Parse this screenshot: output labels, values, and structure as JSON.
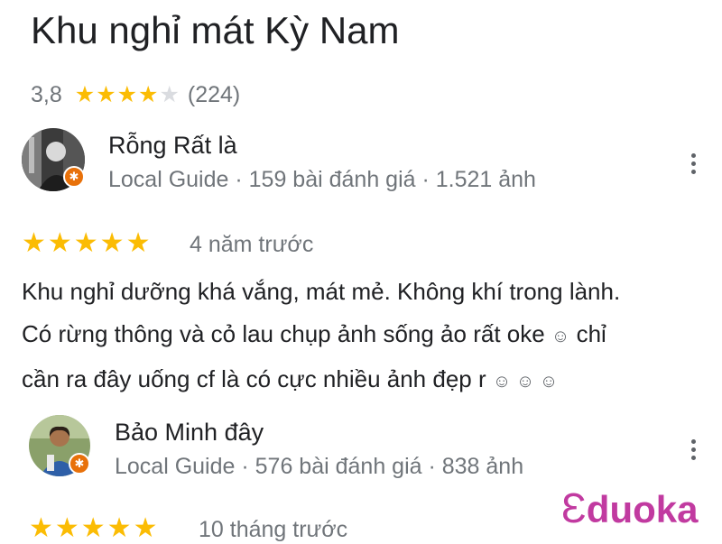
{
  "place": {
    "title": "Khu nghỉ mát Kỳ Nam",
    "rating": "3,8",
    "stars_filled": 4,
    "stars_total": 5,
    "review_count": "(224)"
  },
  "reviews": [
    {
      "name": "Rỗng Rất là",
      "meta": "Local Guide · 159 bài đánh giá · 1.521 ảnh",
      "stars": "★★★★★",
      "time": "4 năm trước",
      "text_lines": [
        "Khu nghỉ dưỡng khá vắng, mát mẻ. Không khí trong lành.",
        "Có rừng thông và cỏ lau chụp ảnh sống ảo rất oke",
        "chỉ",
        "cần ra đây uống cf là có cực nhiều ảnh đẹp r"
      ],
      "emoji": "☺",
      "emoji_triple": "☺ ☺ ☺"
    },
    {
      "name": "Bảo Minh đây",
      "meta": "Local Guide · 576 bài đánh giá · 838 ảnh",
      "stars": "★★★★★",
      "time": "10 tháng trước"
    }
  ],
  "badge_glyph": "✱",
  "watermark": {
    "initial": "Ɛ",
    "rest": "duoka"
  },
  "colors": {
    "star": "#fbbc04",
    "meta": "#70757a",
    "badge": "#e8710a",
    "watermark": "#c13aa0"
  },
  "icons": [
    "more-vert-icon",
    "local-guide-badge-icon",
    "star-icon"
  ]
}
